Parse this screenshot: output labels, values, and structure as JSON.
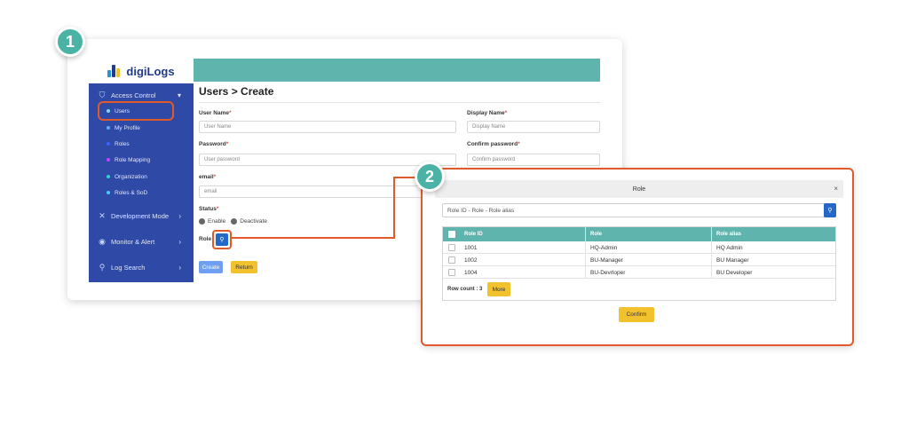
{
  "steps": {
    "one": "1",
    "two": "2"
  },
  "brand": {
    "name": "digiLogs"
  },
  "sidebar": {
    "groups": [
      {
        "label": "Access Control",
        "icon": "shield-icon"
      },
      {
        "label": "Development Mode",
        "icon": "tools-icon"
      },
      {
        "label": "Monitor & Alert",
        "icon": "eye-icon"
      },
      {
        "label": "Log Search",
        "icon": "search-icon"
      }
    ],
    "sub_items": [
      {
        "label": "Users",
        "dot": "#7fd6ff"
      },
      {
        "label": "My Profile",
        "dot": "#5aa7ff"
      },
      {
        "label": "Roles",
        "dot": "#3a63ff"
      },
      {
        "label": "Role Mapping",
        "dot": "#c740ff"
      },
      {
        "label": "Organization",
        "dot": "#2ed3c6"
      },
      {
        "label": "Roles & SoD",
        "dot": "#46c7ff"
      }
    ]
  },
  "form": {
    "title": "Users > Create",
    "user_name_label": "User Name",
    "user_name_placeholder": "User Name",
    "display_name_label": "Display Name",
    "display_name_placeholder": "Display Name",
    "password_label": "Password",
    "password_placeholder": "User password",
    "confirm_label": "Confirm password",
    "confirm_placeholder": "Confirm password",
    "email_label": "email",
    "email_placeholder": "email",
    "required_mark": "*",
    "status_label": "Status",
    "status_enable": "Enable",
    "status_deactivate": "Deactivate",
    "role_label": "Role",
    "create_label": "Create",
    "return_label": "Return"
  },
  "modal": {
    "title": "Role",
    "close": "×",
    "search_placeholder": "Role ID - Role - Role alias",
    "columns": [
      "Role ID",
      "Role",
      "Role alias"
    ],
    "rows": [
      {
        "id": "1001",
        "role": "HQ-Admin",
        "alias": "HQ Admin"
      },
      {
        "id": "1002",
        "role": "BU-Manager",
        "alias": "BU Manager"
      },
      {
        "id": "1004",
        "role": "BU-Devrloper",
        "alias": "BU Developer"
      }
    ],
    "row_count": "Row count : 3",
    "more_label": "More",
    "confirm_label": "Confirm"
  },
  "colors": {
    "accent": "#5fb5ad",
    "sidebar": "#2f49a6",
    "highlight": "#e35a2a",
    "button_yellow": "#f2c12e",
    "button_blue": "#2569c8"
  }
}
